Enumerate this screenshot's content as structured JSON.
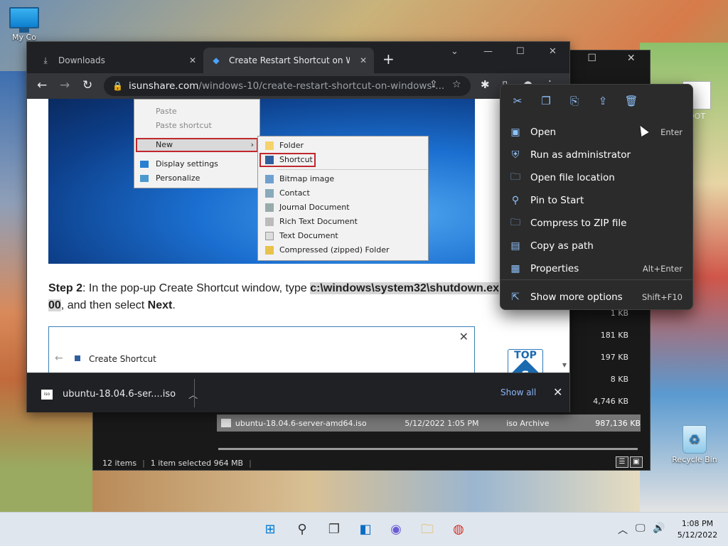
{
  "desktop": {
    "mypc_label": "My Co",
    "recycle_label": "Recycle Bin"
  },
  "explorer": {
    "side_label": "OOT",
    "rows": [
      {
        "size": "1 KB"
      },
      {
        "size": "181 KB"
      },
      {
        "size": "197 KB"
      },
      {
        "size": "8 KB"
      },
      {
        "size": "4,746 KB"
      }
    ],
    "selected": {
      "name": "ubuntu-18.04.6-server-amd64.iso",
      "date": "5/12/2022 1:05 PM",
      "type": "iso Archive",
      "size": "987,136 KB"
    },
    "status": {
      "items": "12 items",
      "selected": "1 item selected  964 MB"
    }
  },
  "chrome": {
    "tabs": [
      {
        "title": "Downloads"
      },
      {
        "title": "Create Restart Shortcut on Windo"
      }
    ],
    "url_domain": "isunshare.com",
    "url_path": "/windows-10/create-restart-shortcut-on-windows-...",
    "page": {
      "ctx1": {
        "paste": "Paste",
        "paste_shortcut": "Paste shortcut",
        "new": "New",
        "display": "Display settings",
        "personalize": "Personalize"
      },
      "ctx2": [
        "Folder",
        "Shortcut",
        "Bitmap image",
        "Contact",
        "Journal Document",
        "Rich Text Document",
        "Text Document",
        "Compressed (zipped) Folder"
      ],
      "step_label": "Step 2",
      "step_text1": ": In the pop-up Create Shortcut window, type ",
      "step_cmd": "c:\\windows\\system32\\shutdown.ex",
      "step_cmd2": "00",
      "step_text2": ", and then select ",
      "step_next": "Next",
      "step_end": ".",
      "dialog_title": "Create Shortcut",
      "top_badge": "TOP",
      "top_s": "S"
    },
    "download": {
      "file": "ubuntu-18.04.6-ser....iso",
      "icon_text": "iso",
      "show_all": "Show all"
    }
  },
  "context_menu": {
    "items": [
      {
        "label": "Open",
        "accel": "Enter",
        "icon": "open-icon"
      },
      {
        "label": "Run as administrator",
        "accel": "",
        "icon": "shield-icon"
      },
      {
        "label": "Open file location",
        "accel": "",
        "icon": "folder-icon"
      },
      {
        "label": "Pin to Start",
        "accel": "",
        "icon": "pin-icon"
      },
      {
        "label": "Compress to ZIP file",
        "accel": "",
        "icon": "zip-icon"
      },
      {
        "label": "Copy as path",
        "accel": "",
        "icon": "path-icon"
      },
      {
        "label": "Properties",
        "accel": "Alt+Enter",
        "icon": "properties-icon"
      },
      {
        "label": "Show more options",
        "accel": "Shift+F10",
        "icon": "more-options-icon"
      }
    ]
  },
  "taskbar": {
    "time": "1:08 PM",
    "date": "5/12/2022"
  }
}
